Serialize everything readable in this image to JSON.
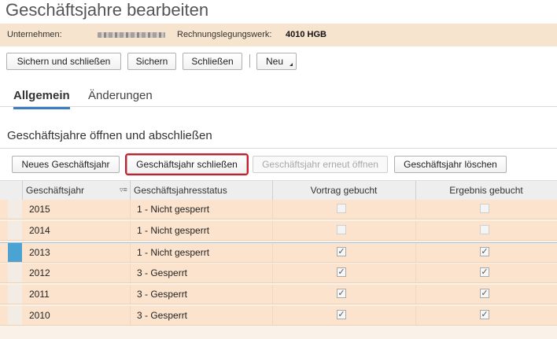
{
  "page": {
    "title": "Geschäftsjahre bearbeiten"
  },
  "info": {
    "company_label": "Unternehmen:",
    "accounting_label": "Rechnungslegungswerk:",
    "accounting_value": "4010 HGB"
  },
  "toolbar": {
    "save_close": "Sichern und schließen",
    "save": "Sichern",
    "close": "Schließen",
    "new": "Neu"
  },
  "tabs": [
    {
      "label": "Allgemein",
      "active": true
    },
    {
      "label": "Änderungen",
      "active": false
    }
  ],
  "section": {
    "title": "Geschäftsjahre öffnen und abschließen",
    "buttons": {
      "new_year": "Neues Geschäftsjahr",
      "close_year": "Geschäftsjahr schließen",
      "reopen_year": "Geschäftsjahr erneut öffnen",
      "delete_year": "Geschäftsjahr löschen"
    }
  },
  "table": {
    "columns": [
      "Geschäftsjahr",
      "Geschäftsjahresstatus",
      "Vortrag gebucht",
      "Ergebnis gebucht"
    ],
    "rows": [
      {
        "year": "2015",
        "status": "1 - Nicht gesperrt",
        "vortrag": false,
        "ergebnis": false,
        "selected": false
      },
      {
        "year": "2014",
        "status": "1 - Nicht gesperrt",
        "vortrag": false,
        "ergebnis": false,
        "selected": false
      },
      {
        "year": "2013",
        "status": "1 - Nicht gesperrt",
        "vortrag": true,
        "ergebnis": true,
        "selected": true
      },
      {
        "year": "2012",
        "status": "3 - Gesperrt",
        "vortrag": true,
        "ergebnis": true,
        "selected": false
      },
      {
        "year": "2011",
        "status": "3 - Gesperrt",
        "vortrag": true,
        "ergebnis": true,
        "selected": false
      },
      {
        "year": "2010",
        "status": "3 - Gesperrt",
        "vortrag": true,
        "ergebnis": true,
        "selected": false
      }
    ]
  },
  "icons": {
    "check": "✓",
    "sort": "sort-filter-icon",
    "dropdown": "dropdown-caret-icon"
  }
}
